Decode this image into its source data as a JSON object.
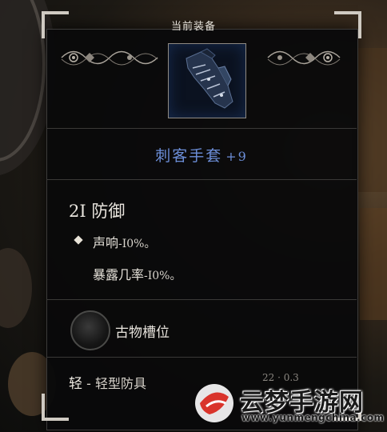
{
  "panel": {
    "title": "当前装备"
  },
  "item": {
    "name": "刺客手套",
    "upgrade": "+9",
    "icon": "gauntlet-icon"
  },
  "defense": {
    "value": "2I",
    "label": "防御"
  },
  "effects": [
    {
      "label": "声响",
      "value": "-I0%。"
    },
    {
      "label": "暴露几率",
      "value": "-I0%。"
    }
  ],
  "slot": {
    "label": "古物槽位"
  },
  "footer": {
    "weight_class": "轻",
    "separator": " - ",
    "category": "轻型防具",
    "stats_partial": "22 · 0.3"
  },
  "watermark": {
    "text": "云梦手游网",
    "url": "www.yunmengchina.com"
  },
  "colors": {
    "item_name": "#6c8ed8",
    "panel_bg": "#09090a",
    "frame_corner": "#cfcac2"
  }
}
